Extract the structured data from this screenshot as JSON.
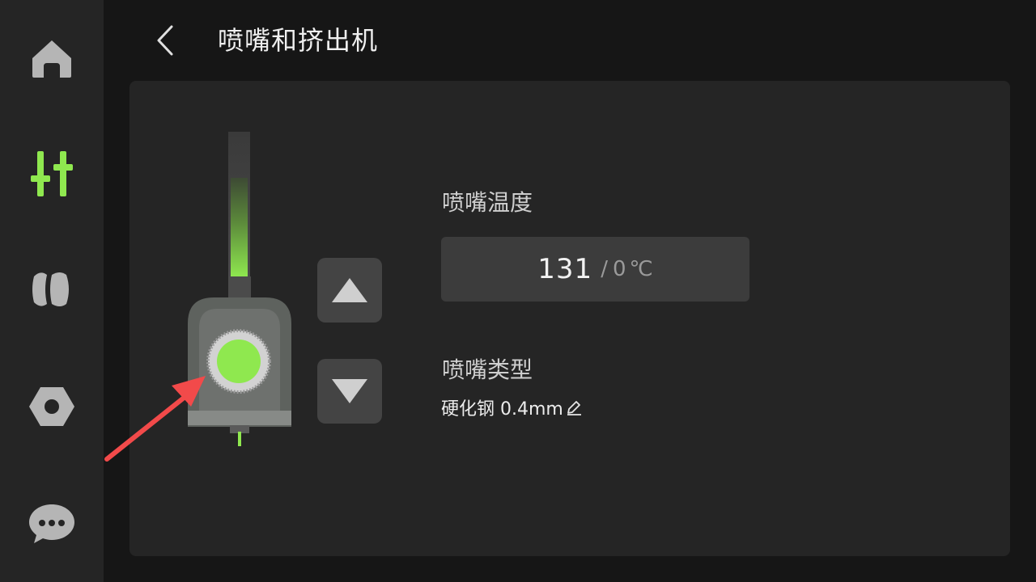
{
  "colors": {
    "accent": "#8fe84f",
    "icon_gray": "#b5b5b5",
    "annotation_red": "#f24a4a"
  },
  "sidebar": {
    "items": [
      {
        "id": "home",
        "icon": "home-icon",
        "active": false
      },
      {
        "id": "controls",
        "icon": "sliders-icon",
        "active": true
      },
      {
        "id": "filament",
        "icon": "filament-spool-icon",
        "active": false
      },
      {
        "id": "settings",
        "icon": "hex-nut-icon",
        "active": false
      },
      {
        "id": "messages",
        "icon": "chat-bubble-icon",
        "active": false
      }
    ]
  },
  "header": {
    "title": "喷嘴和挤出机",
    "back_icon": "chevron-left-icon"
  },
  "extruder": {
    "controls": {
      "up_icon": "triangle-up-icon",
      "down_icon": "triangle-down-icon"
    }
  },
  "nozzle_temperature": {
    "label": "喷嘴温度",
    "current": "131",
    "separator": "/",
    "target": "0",
    "unit": "℃"
  },
  "nozzle_type": {
    "label": "喷嘴类型",
    "value": "硬化钢 0.4mm",
    "edit_icon": "pencil-icon"
  }
}
